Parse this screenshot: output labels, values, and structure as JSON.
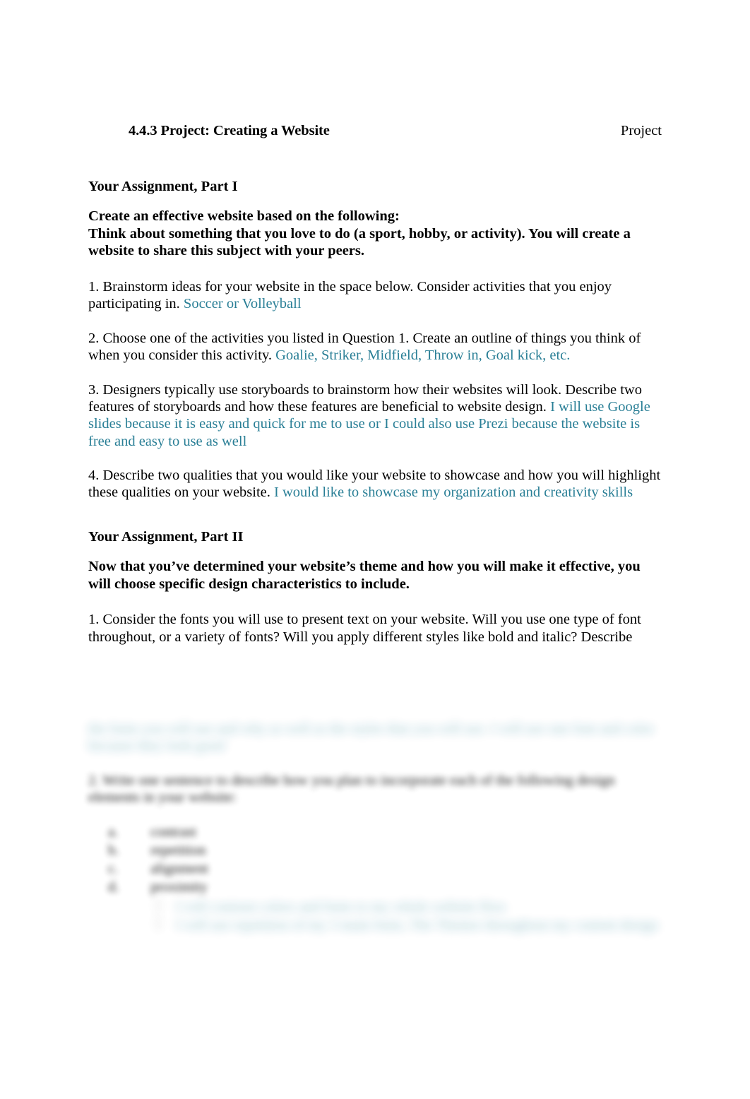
{
  "document": {
    "header": {
      "title": "4.4.3 Project: Creating a Website",
      "right_label": "Project"
    },
    "accent_color": "#2a7f96",
    "text_color": "#000000",
    "background_color": "#ffffff"
  },
  "part_one": {
    "heading": "Your Assignment, Part I",
    "lead_line_1": "Create an effective website based on the following:",
    "lead_line_2": "Think about something that you love to do (a sport, hobby, or activity). You will create a website to share this subject with your peers.",
    "questions": [
      {
        "prompt": "1. Brainstorm ideas for your website in the space below. Consider activities that you enjoy participating in.",
        "answer": "Soccer or Volleyball"
      },
      {
        "prompt": "2. Choose one of the activities you listed in Question 1. Create an outline of things you think of when you consider this activity.",
        "answer": "Goalie, Striker, Midfield, Throw in, Goal kick, etc."
      },
      {
        "prompt": "3. Designers typically use storyboards to brainstorm how their websites will look. Describe two features of storyboards and how these features are beneficial to website design.",
        "answer": "I will use Google slides because it is easy and quick for me to use or I could also use Prezi because the website is free and easy to use as well"
      },
      {
        "prompt": "4. Describe two qualities that you would like your website to showcase and how you will highlight these qualities on your website.",
        "answer": "I would like to showcase my organization and creativity skills"
      }
    ]
  },
  "part_two": {
    "heading": "Your Assignment, Part II",
    "lead": "Now that you’ve determined your website’s theme and how you will make it effective, you will choose specific design characteristics to include.",
    "questions": [
      {
        "prompt": "1. Consider the fonts you will use to present text on your website. Will you use one type of font throughout, or a variety of fonts? Will you apply different styles like bold and italic? Describe",
        "answer": ""
      }
    ]
  },
  "obscured_region": {
    "note_visible_as": "blurred",
    "answer_continuation": "the fonts you will use and why as well as the styles that you will use. I will use one font and color because they look good",
    "question_prompt": "2. Write one sentence to describe how you plan to incorporate each of the following design elements in your website:",
    "list_items": [
      {
        "marker": "a.",
        "label": "contrast"
      },
      {
        "marker": "b.",
        "label": "repetition"
      },
      {
        "marker": "c.",
        "label": "alignment"
      },
      {
        "marker": "d.",
        "label": "proximity"
      }
    ],
    "sub_answers": [
      "I will contrast colors and fonts to my whole website flow",
      "I will use repetition of my 3 main fonts, The Themes throughout my content design"
    ]
  }
}
